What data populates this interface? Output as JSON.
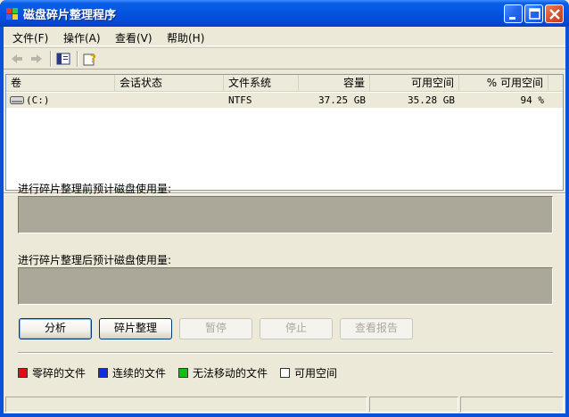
{
  "window": {
    "title": "磁盘碎片整理程序",
    "icon": "defrag-app-icon",
    "controls": [
      "minimize-icon",
      "maximize-icon",
      "close-icon"
    ]
  },
  "menu": [
    {
      "label": "文件(F)"
    },
    {
      "label": "操作(A)"
    },
    {
      "label": "查看(V)"
    },
    {
      "label": "帮助(H)"
    }
  ],
  "toolbar": [
    "back-arrow-icon",
    "forward-arrow-icon",
    "show-hide-tree-icon",
    "help-icon"
  ],
  "volumes": {
    "columns": [
      "卷",
      "会话状态",
      "文件系统",
      "容量",
      "可用空间",
      "% 可用空间"
    ],
    "rows": [
      {
        "volume": "(C:)",
        "status": "",
        "fs": "NTFS",
        "capacity": "37.25 GB",
        "free": "35.28 GB",
        "pct": "94 %"
      }
    ]
  },
  "panels": {
    "before_label": "进行碎片整理前预计磁盘使用量:",
    "after_label": "进行碎片整理后预计磁盘使用量:"
  },
  "buttons": {
    "analyze": "分析",
    "defragment": "碎片整理",
    "pause": "暂停",
    "stop": "停止",
    "report": "查看报告"
  },
  "legend": [
    {
      "label": "零碎的文件",
      "color": "#e01010"
    },
    {
      "label": "连续的文件",
      "color": "#1030e0"
    },
    {
      "label": "无法移动的文件",
      "color": "#10c010"
    },
    {
      "label": "可用空间",
      "color": "#ffffff"
    }
  ]
}
